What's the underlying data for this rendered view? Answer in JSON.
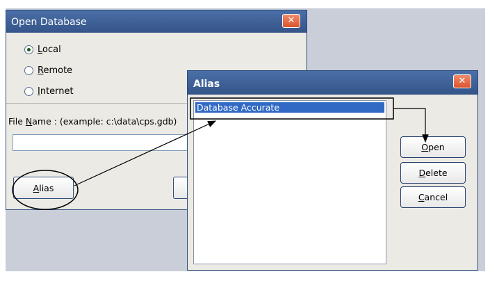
{
  "open_database": {
    "title": "Open Database",
    "close_label": "✕",
    "radio_options": [
      {
        "key": "L",
        "rest": "ocal",
        "selected": true
      },
      {
        "key": "R",
        "rest": "emote",
        "selected": false
      },
      {
        "key": "I",
        "rest": "nternet",
        "selected": false
      }
    ],
    "file_name_prefix": "File ",
    "file_name_key": "N",
    "file_name_rest": "ame :  (example: c:\\data\\cps.gdb)",
    "file_name_value": "",
    "alias_key": "A",
    "alias_rest": "lias"
  },
  "alias_window": {
    "title": "Alias",
    "close_label": "✕",
    "list_items": [
      "Database Accurate"
    ],
    "buttons": {
      "open": {
        "key": "O",
        "rest": "pen"
      },
      "delete": {
        "key": "D",
        "rest": "elete"
      },
      "cancel": {
        "key": "C",
        "rest": "ancel"
      }
    }
  },
  "colors": {
    "titlebar": "#3d5f94",
    "selection": "#316ac5",
    "close_button": "#d9552f",
    "window_bg": "#eceae4"
  }
}
